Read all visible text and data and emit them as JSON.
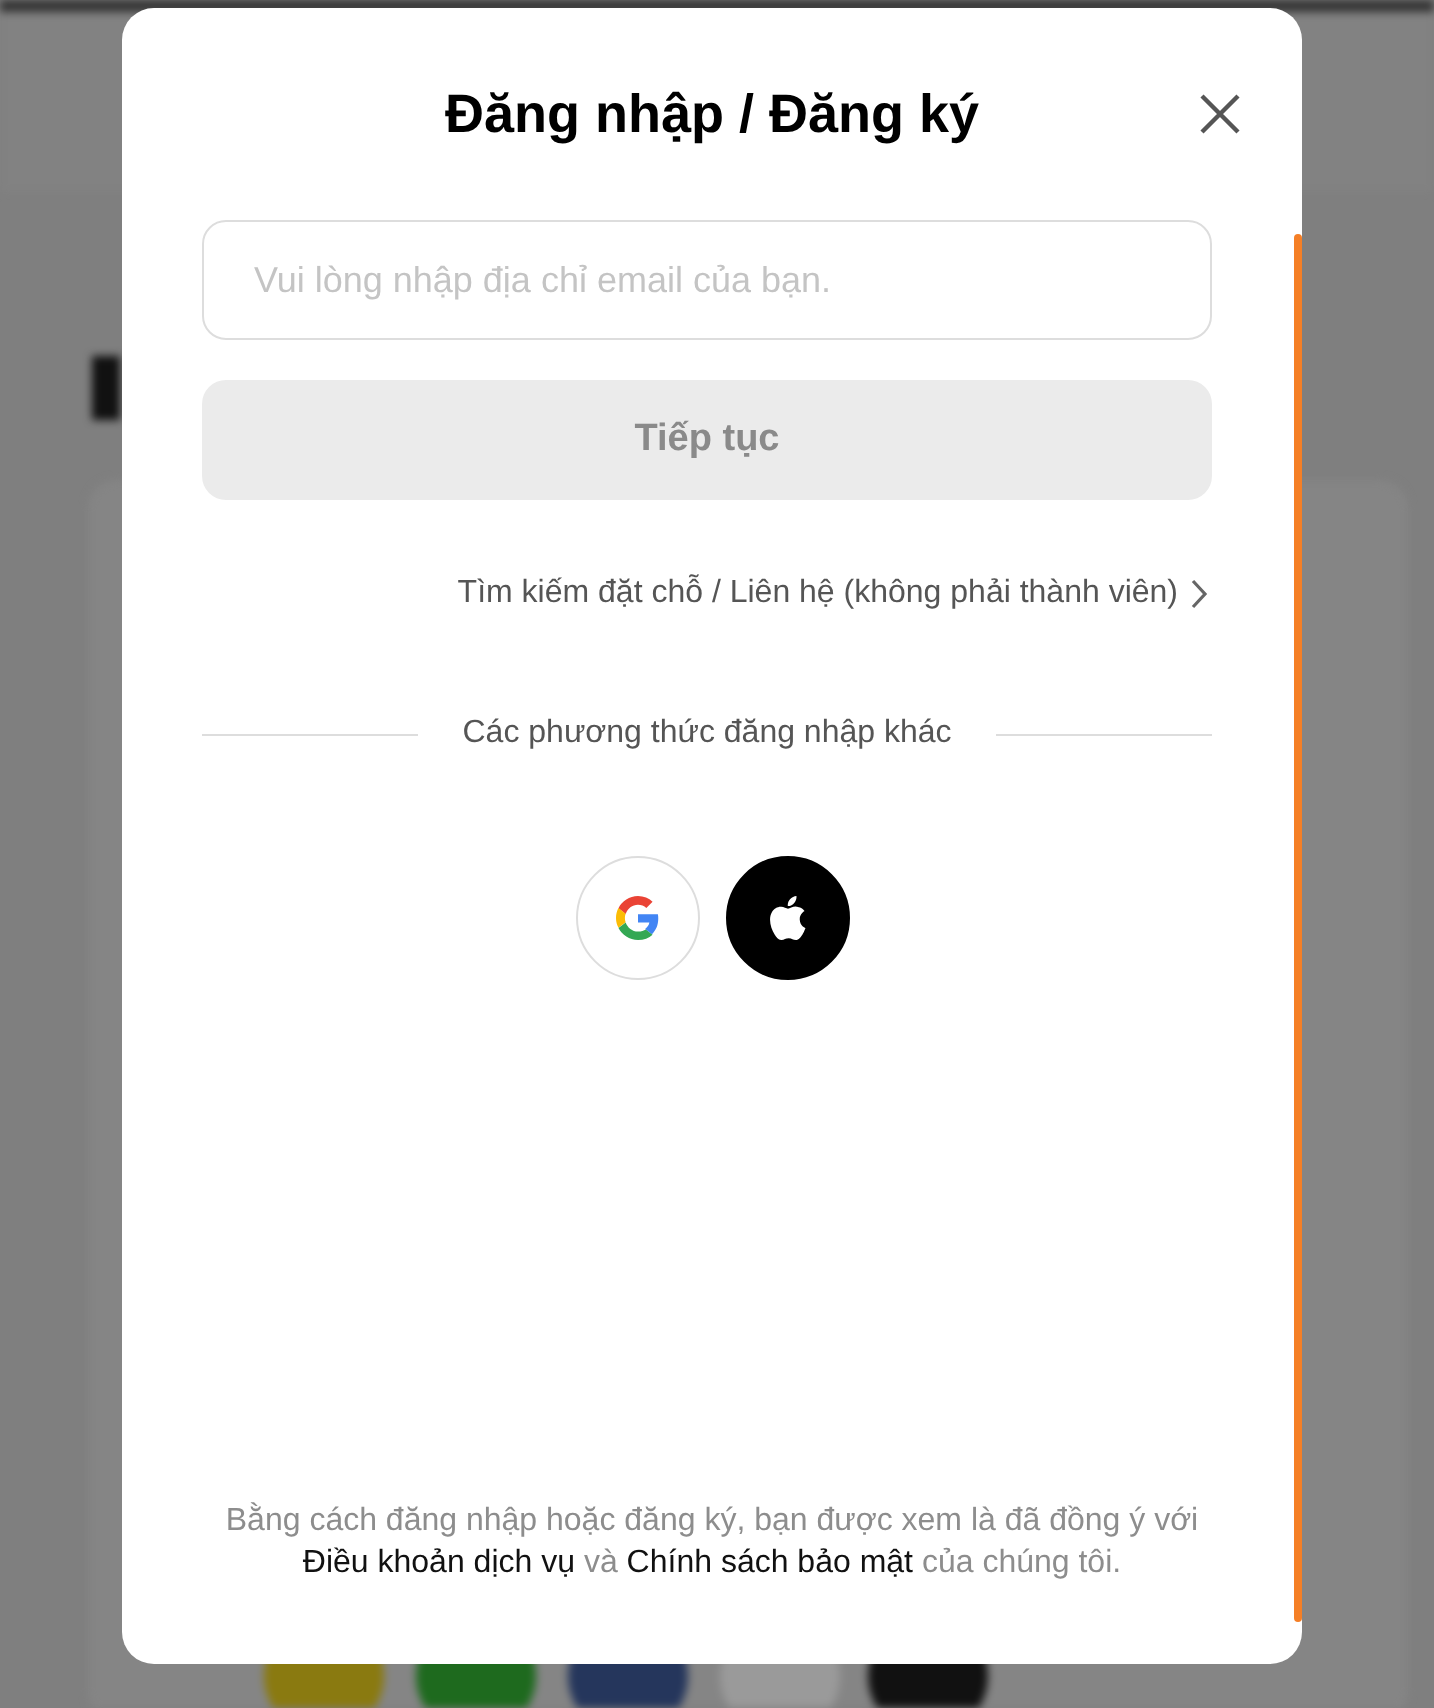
{
  "title": "Đăng nhập / Đăng ký",
  "email_field": {
    "placeholder": "Vui lòng nhập địa chỉ email của bạn."
  },
  "continue_button": {
    "label": "Tiếp tục",
    "disabled": true
  },
  "guest_link": {
    "label": "Tìm kiếm đặt chỗ / Liên hệ (không phải thành viên)"
  },
  "divider_label": "Các phương thức đăng nhập khác",
  "social_buttons": [
    {
      "kind": "google"
    },
    {
      "kind": "apple"
    }
  ],
  "legal": [
    {
      "kind": "text",
      "text": "Bằng cách đăng nhập hoặc đăng ký, bạn được xem là đã đồng ý với "
    },
    {
      "kind": "link",
      "text": "Điều khoản dịch vụ"
    },
    {
      "kind": "text",
      "text": " và "
    },
    {
      "kind": "link",
      "text": "Chính sách bảo mật"
    },
    {
      "kind": "text",
      "text": " của chúng tôi."
    }
  ]
}
